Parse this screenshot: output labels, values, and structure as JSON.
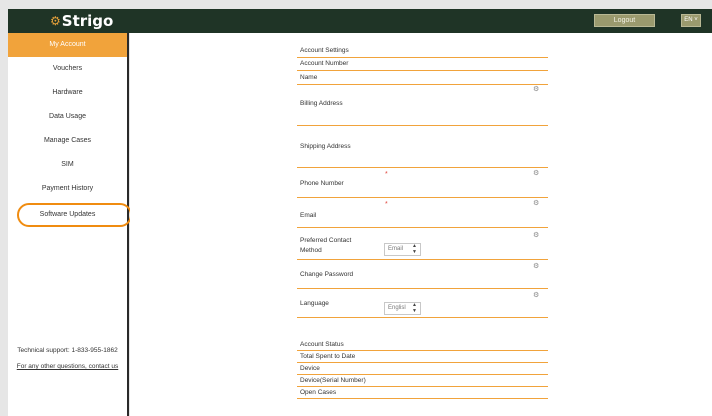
{
  "header": {
    "logo_text": "Strigo",
    "logout_label": "Logout",
    "language_label": "EN ˅"
  },
  "sidebar": {
    "items": [
      {
        "label": "My Account",
        "active": true
      },
      {
        "label": "Vouchers"
      },
      {
        "label": "Hardware"
      },
      {
        "label": "Data Usage"
      },
      {
        "label": "Manage Cases"
      },
      {
        "label": "SIM"
      },
      {
        "label": "Payment History"
      },
      {
        "label": "Software Updates",
        "highlighted": true
      }
    ],
    "support_text": "Technical support: 1-833-955-1862",
    "contact_link": "For any other questions, contact us"
  },
  "account_settings": {
    "title": "Account Settings",
    "account_number_label": "Account Number",
    "name_label": "Name",
    "billing_address_label": "Billing Address",
    "shipping_address_label": "Shipping Address",
    "phone_number_label": "Phone Number",
    "email_label": "Email",
    "preferred_contact_label_line1": "Preferred Contact",
    "preferred_contact_label_line2": "Method",
    "preferred_contact_value": "Email",
    "change_password_label": "Change Password",
    "language_label": "Language",
    "language_value": "Englisl",
    "required_marker": "*"
  },
  "account_status": {
    "title": "Account Status",
    "total_spent_label": "Total Spent to Date",
    "device_label": "Device",
    "device_serial_label": "Device(Serial Number)",
    "open_cases_label": "Open Cases"
  },
  "icons": {
    "gear": "gear-icon",
    "select_arrows": "updown-arrows-icon"
  },
  "colors": {
    "header_bg": "#1f3426",
    "accent_orange": "#f1a33b",
    "highlight_circle": "#f08c10",
    "button_bg": "#9a9a6e",
    "required_red": "#e0453a"
  }
}
